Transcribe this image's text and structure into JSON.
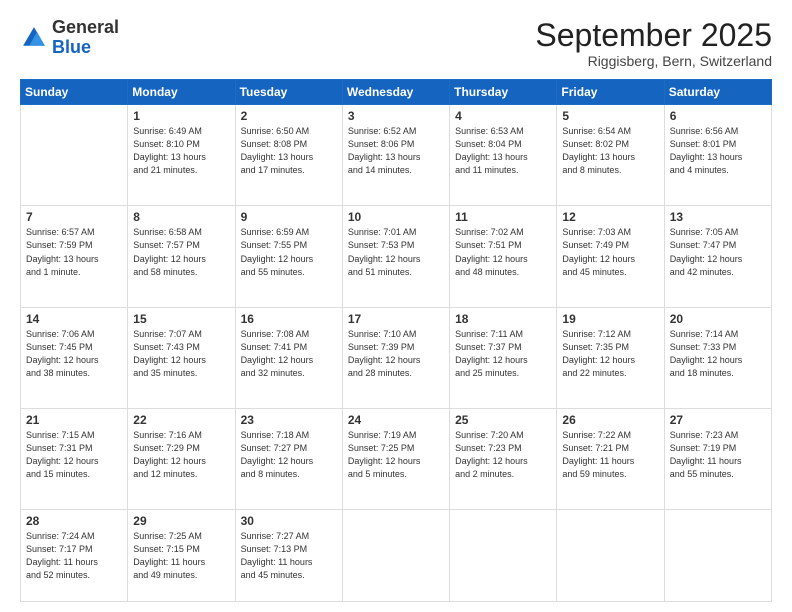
{
  "header": {
    "logo_general": "General",
    "logo_blue": "Blue",
    "month_title": "September 2025",
    "location": "Riggisberg, Bern, Switzerland"
  },
  "days_of_week": [
    "Sunday",
    "Monday",
    "Tuesday",
    "Wednesday",
    "Thursday",
    "Friday",
    "Saturday"
  ],
  "weeks": [
    [
      {
        "day": "",
        "info": ""
      },
      {
        "day": "1",
        "info": "Sunrise: 6:49 AM\nSunset: 8:10 PM\nDaylight: 13 hours\nand 21 minutes."
      },
      {
        "day": "2",
        "info": "Sunrise: 6:50 AM\nSunset: 8:08 PM\nDaylight: 13 hours\nand 17 minutes."
      },
      {
        "day": "3",
        "info": "Sunrise: 6:52 AM\nSunset: 8:06 PM\nDaylight: 13 hours\nand 14 minutes."
      },
      {
        "day": "4",
        "info": "Sunrise: 6:53 AM\nSunset: 8:04 PM\nDaylight: 13 hours\nand 11 minutes."
      },
      {
        "day": "5",
        "info": "Sunrise: 6:54 AM\nSunset: 8:02 PM\nDaylight: 13 hours\nand 8 minutes."
      },
      {
        "day": "6",
        "info": "Sunrise: 6:56 AM\nSunset: 8:01 PM\nDaylight: 13 hours\nand 4 minutes."
      }
    ],
    [
      {
        "day": "7",
        "info": "Sunrise: 6:57 AM\nSunset: 7:59 PM\nDaylight: 13 hours\nand 1 minute."
      },
      {
        "day": "8",
        "info": "Sunrise: 6:58 AM\nSunset: 7:57 PM\nDaylight: 12 hours\nand 58 minutes."
      },
      {
        "day": "9",
        "info": "Sunrise: 6:59 AM\nSunset: 7:55 PM\nDaylight: 12 hours\nand 55 minutes."
      },
      {
        "day": "10",
        "info": "Sunrise: 7:01 AM\nSunset: 7:53 PM\nDaylight: 12 hours\nand 51 minutes."
      },
      {
        "day": "11",
        "info": "Sunrise: 7:02 AM\nSunset: 7:51 PM\nDaylight: 12 hours\nand 48 minutes."
      },
      {
        "day": "12",
        "info": "Sunrise: 7:03 AM\nSunset: 7:49 PM\nDaylight: 12 hours\nand 45 minutes."
      },
      {
        "day": "13",
        "info": "Sunrise: 7:05 AM\nSunset: 7:47 PM\nDaylight: 12 hours\nand 42 minutes."
      }
    ],
    [
      {
        "day": "14",
        "info": "Sunrise: 7:06 AM\nSunset: 7:45 PM\nDaylight: 12 hours\nand 38 minutes."
      },
      {
        "day": "15",
        "info": "Sunrise: 7:07 AM\nSunset: 7:43 PM\nDaylight: 12 hours\nand 35 minutes."
      },
      {
        "day": "16",
        "info": "Sunrise: 7:08 AM\nSunset: 7:41 PM\nDaylight: 12 hours\nand 32 minutes."
      },
      {
        "day": "17",
        "info": "Sunrise: 7:10 AM\nSunset: 7:39 PM\nDaylight: 12 hours\nand 28 minutes."
      },
      {
        "day": "18",
        "info": "Sunrise: 7:11 AM\nSunset: 7:37 PM\nDaylight: 12 hours\nand 25 minutes."
      },
      {
        "day": "19",
        "info": "Sunrise: 7:12 AM\nSunset: 7:35 PM\nDaylight: 12 hours\nand 22 minutes."
      },
      {
        "day": "20",
        "info": "Sunrise: 7:14 AM\nSunset: 7:33 PM\nDaylight: 12 hours\nand 18 minutes."
      }
    ],
    [
      {
        "day": "21",
        "info": "Sunrise: 7:15 AM\nSunset: 7:31 PM\nDaylight: 12 hours\nand 15 minutes."
      },
      {
        "day": "22",
        "info": "Sunrise: 7:16 AM\nSunset: 7:29 PM\nDaylight: 12 hours\nand 12 minutes."
      },
      {
        "day": "23",
        "info": "Sunrise: 7:18 AM\nSunset: 7:27 PM\nDaylight: 12 hours\nand 8 minutes."
      },
      {
        "day": "24",
        "info": "Sunrise: 7:19 AM\nSunset: 7:25 PM\nDaylight: 12 hours\nand 5 minutes."
      },
      {
        "day": "25",
        "info": "Sunrise: 7:20 AM\nSunset: 7:23 PM\nDaylight: 12 hours\nand 2 minutes."
      },
      {
        "day": "26",
        "info": "Sunrise: 7:22 AM\nSunset: 7:21 PM\nDaylight: 11 hours\nand 59 minutes."
      },
      {
        "day": "27",
        "info": "Sunrise: 7:23 AM\nSunset: 7:19 PM\nDaylight: 11 hours\nand 55 minutes."
      }
    ],
    [
      {
        "day": "28",
        "info": "Sunrise: 7:24 AM\nSunset: 7:17 PM\nDaylight: 11 hours\nand 52 minutes."
      },
      {
        "day": "29",
        "info": "Sunrise: 7:25 AM\nSunset: 7:15 PM\nDaylight: 11 hours\nand 49 minutes."
      },
      {
        "day": "30",
        "info": "Sunrise: 7:27 AM\nSunset: 7:13 PM\nDaylight: 11 hours\nand 45 minutes."
      },
      {
        "day": "",
        "info": ""
      },
      {
        "day": "",
        "info": ""
      },
      {
        "day": "",
        "info": ""
      },
      {
        "day": "",
        "info": ""
      }
    ]
  ]
}
